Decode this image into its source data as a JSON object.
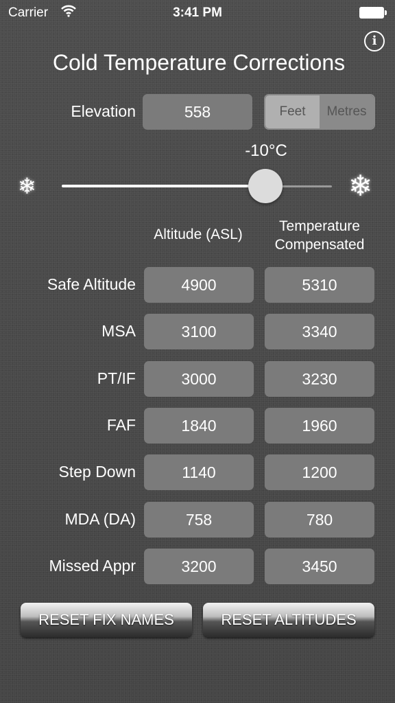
{
  "status_bar": {
    "carrier": "Carrier",
    "time": "3:41 PM"
  },
  "title": "Cold Temperature Corrections",
  "elevation": {
    "label": "Elevation",
    "value": "558"
  },
  "units": {
    "options": [
      "Feet",
      "Metres"
    ],
    "selected": "Feet"
  },
  "temperature": {
    "label": "-10°C",
    "slider_fraction": 0.74
  },
  "table": {
    "col_altitude": "Altitude (ASL)",
    "col_comp_line1": "Temperature",
    "col_comp_line2": "Compensated",
    "rows": [
      {
        "name": "Safe Altitude",
        "altitude": "4900",
        "compensated": "5310"
      },
      {
        "name": "MSA",
        "altitude": "3100",
        "compensated": "3340"
      },
      {
        "name": "PT/IF",
        "altitude": "3000",
        "compensated": "3230"
      },
      {
        "name": "FAF",
        "altitude": "1840",
        "compensated": "1960"
      },
      {
        "name": "Step Down",
        "altitude": "1140",
        "compensated": "1200"
      },
      {
        "name": "MDA (DA)",
        "altitude": "758",
        "compensated": "780"
      },
      {
        "name": "Missed Appr",
        "altitude": "3200",
        "compensated": "3450"
      }
    ]
  },
  "buttons": {
    "reset_fix_names": "RESET FIX NAMES",
    "reset_altitudes": "RESET ALTITUDES"
  },
  "icons": {
    "info": "info-icon",
    "wifi": "wifi-icon",
    "battery": "battery-icon",
    "cold": "snowflake-icon",
    "colder": "snowflake-icon"
  }
}
